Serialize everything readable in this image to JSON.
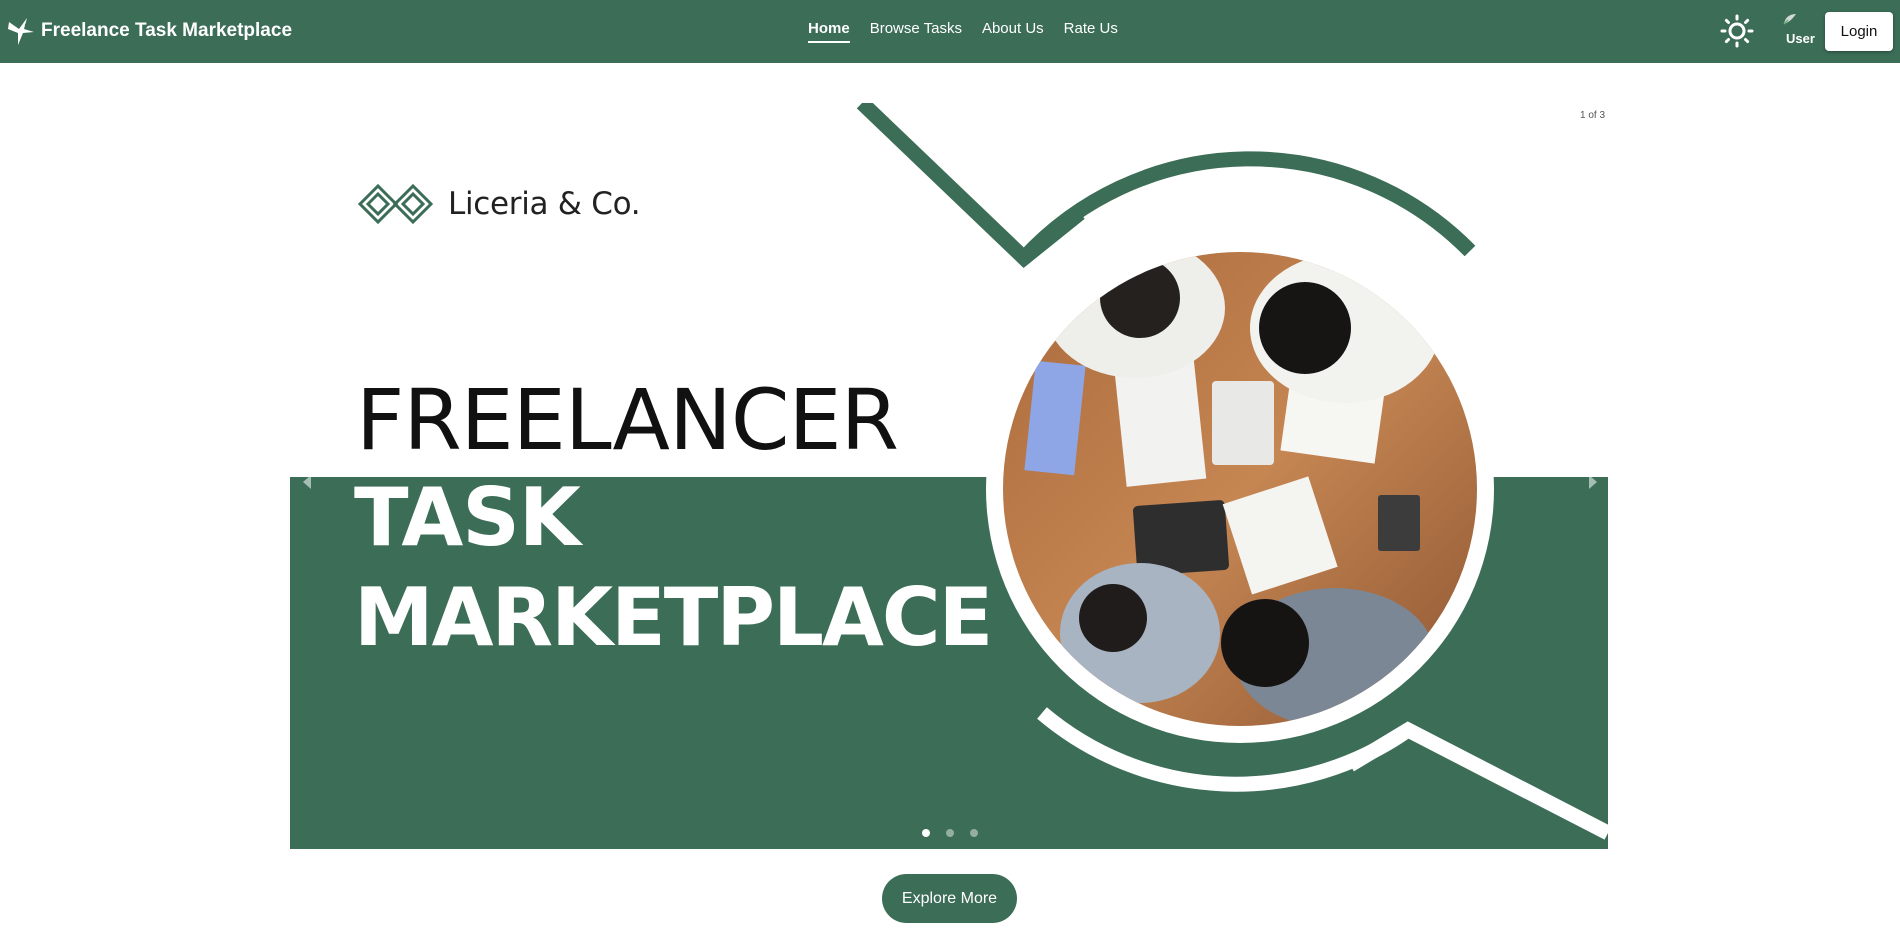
{
  "navbar": {
    "brand_title": "Freelance Task Marketplace",
    "links": [
      "Home",
      "Browse Tasks",
      "About Us",
      "Rate Us"
    ],
    "active_link": "Home",
    "user_label": "User",
    "login_label": "Login",
    "icons": {
      "brand": "hummingbird-logo-icon",
      "theme": "sun-icon",
      "avatar": "user-avatar-icon"
    }
  },
  "carousel": {
    "counter": "1 of 3",
    "company_name": "Liceria & Co.",
    "hero_line1": "FREELANCER",
    "hero_line2": "TASK",
    "hero_line3": "MARKETPLACE",
    "slide_count": 3,
    "active_slide": 1,
    "icons": {
      "prev": "chevron-left-icon",
      "next": "chevron-right-icon"
    }
  },
  "explore_label": "Explore More",
  "colors": {
    "brand_green": "#3b6d57",
    "white": "#ffffff",
    "text_dark": "#111111"
  }
}
